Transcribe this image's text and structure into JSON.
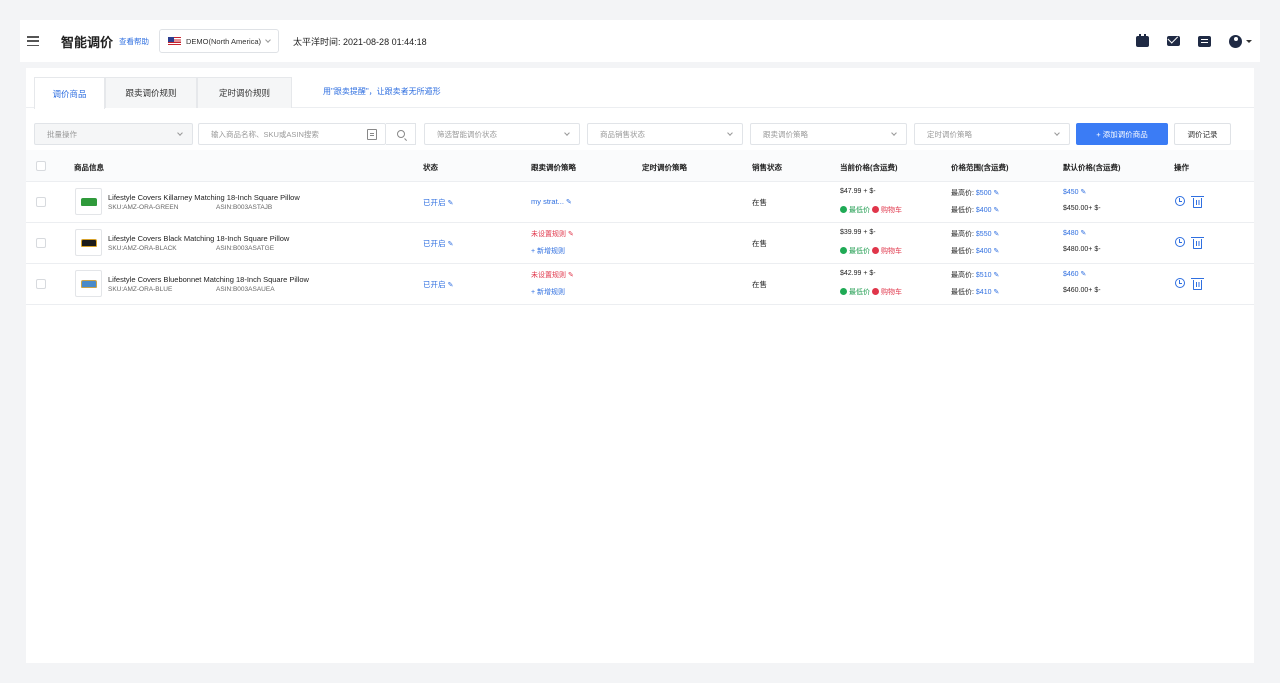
{
  "header": {
    "title": "智能调价",
    "help_link": "查看帮助",
    "region": "DEMO(North America)",
    "time": "太平洋时间: 2021-08-28 01:44:18",
    "icons": [
      "calendar-icon",
      "mail-icon",
      "document-icon",
      "user-avatar-icon"
    ]
  },
  "tabs": [
    {
      "label": "调价商品",
      "active": true
    },
    {
      "label": "跟卖调价规则",
      "active": false
    },
    {
      "label": "定时调价规则",
      "active": false
    }
  ],
  "tab_hint": "用\"跟卖提醒\"，让跟卖者无所遁形",
  "filters": {
    "batch_placeholder": "批量操作",
    "search_placeholder": "输入商品名称、SKU或ASIN搜索",
    "status_placeholder": "筛选智能调价状态",
    "sales_placeholder": "商品销售状态",
    "follow_placeholder": "跟卖调价策略",
    "timed_placeholder": "定时调价策略",
    "add_button": "+ 添加调价商品",
    "log_button": "调价记录"
  },
  "columns": [
    "商品信息",
    "状态",
    "跟卖调价策略",
    "定时调价策略",
    "销售状态",
    "当前价格(含运费)",
    "价格范围(含运费)",
    "默认价格(含运费)",
    "操作"
  ],
  "rows": [
    {
      "name": "Lifestyle Covers Killarney Matching 18-Inch Square Pillow",
      "sku": "SKU:AMZ-ORA-GREEN",
      "asin": "ASIN:B003ASTAJB",
      "status": "已开启",
      "strategy": "my strat...",
      "strategy2": "",
      "sales_status": "在售",
      "current_price": "$47.99 + $-",
      "lowest_label": "最低价",
      "cart_label": "购物车",
      "min_price_label": "最高价:",
      "min_price": "$500",
      "max_price_label": "最低价:",
      "max_price": "$400",
      "default_price": "$450",
      "default_sub": "$450.00+ $-",
      "color": "#2f9a3b"
    },
    {
      "name": "Lifestyle Covers Black Matching 18-Inch Square Pillow",
      "sku": "SKU:AMZ-ORA-BLACK",
      "asin": "ASIN:B003ASATGE",
      "status": "已开启",
      "strategy": "未设置规则",
      "strategy2": "+ 新增规则",
      "sales_status": "在售",
      "current_price": "$39.99 + $-",
      "lowest_label": "最低价",
      "cart_label": "购物车",
      "min_price_label": "最高价:",
      "min_price": "$550",
      "max_price_label": "最低价:",
      "max_price": "$400",
      "default_price": "$480",
      "default_sub": "$480.00+ $-",
      "color": "#1a1a1a"
    },
    {
      "name": "Lifestyle Covers Bluebonnet Matching 18-Inch Square Pillow",
      "sku": "SKU:AMZ-ORA-BLUE",
      "asin": "ASIN:B003ASAUEA",
      "status": "已开启",
      "strategy": "未设置规则",
      "strategy2": "+ 新增规则",
      "sales_status": "在售",
      "current_price": "$42.99 + $-",
      "lowest_label": "最低价",
      "cart_label": "购物车",
      "min_price_label": "最高价:",
      "min_price": "$510",
      "max_price_label": "最低价:",
      "max_price": "$410",
      "default_price": "$460",
      "default_sub": "$460.00+ $-",
      "color": "#4a8ac9"
    }
  ]
}
